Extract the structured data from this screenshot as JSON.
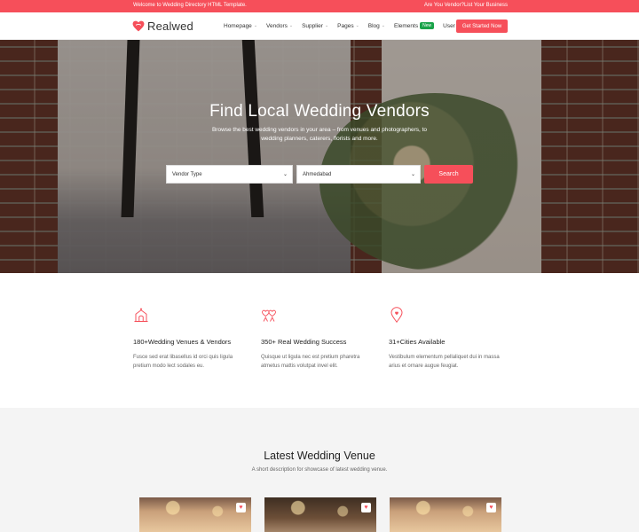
{
  "topbar": {
    "left_text": "Welcome to Wedding Directory HTML Template.",
    "right_text": "Are You Vendor?List Your Business"
  },
  "header": {
    "brand": "Realwed",
    "nav": [
      {
        "label": "Homepage",
        "has_dropdown": true
      },
      {
        "label": "Vendors",
        "has_dropdown": true
      },
      {
        "label": "Supplier",
        "has_dropdown": true
      },
      {
        "label": "Pages",
        "has_dropdown": true
      },
      {
        "label": "Blog",
        "has_dropdown": true
      },
      {
        "label": "Elements",
        "has_dropdown": false,
        "badge": "New"
      },
      {
        "label": "User Panel",
        "has_dropdown": true
      }
    ],
    "cta_label": "Get Started Now"
  },
  "hero": {
    "title": "Find Local Wedding Vendors",
    "subtitle": "Browse the best wedding vendors in your area – from venues and photographers, to wedding planners, caterers, florists and more.",
    "search": {
      "vendor_type_value": "Vendor Type",
      "city_value": "Ahmedabad",
      "button_label": "Search"
    }
  },
  "features": [
    {
      "icon": "venue-icon",
      "title": "180+Wedding Venues & Vendors",
      "text": "Fusce sed erat libasellus id orci quis ligula pretium modo lect sodales eu."
    },
    {
      "icon": "couple-hearts-icon",
      "title": "350+ Real Wedding Success",
      "text": "Quisque ut ligula nec est pretium pharetra atmetus mattis volutpat invel elit."
    },
    {
      "icon": "map-pin-icon",
      "title": "31+Cities Available",
      "text": "Vestibulum elementum pellaliquet dui in massa arius et ornare augue feugiat."
    }
  ],
  "latest": {
    "title": "Latest Wedding Venue",
    "subtitle": "A short description for showcase of latest wedding venue."
  },
  "colors": {
    "accent": "#f64f5a",
    "badge": "#1aa34a",
    "section_bg": "#f4f4f4"
  }
}
